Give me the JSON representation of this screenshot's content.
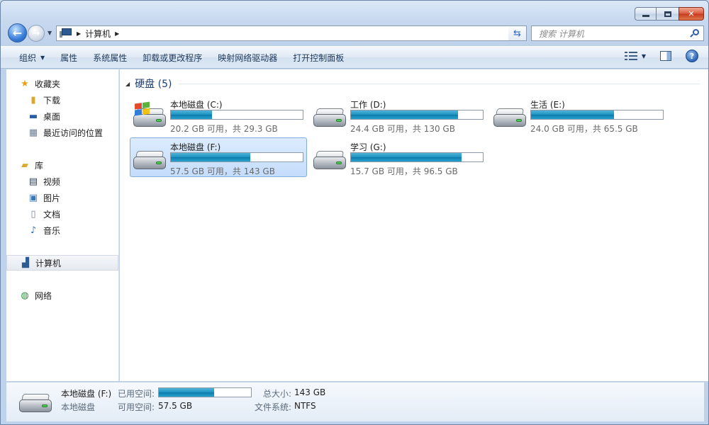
{
  "window": {
    "caption": {
      "minimize": "minimize",
      "maximize": "maximize",
      "close": "✕"
    }
  },
  "nav": {
    "back": "←",
    "forward": "→",
    "breadcrumb": [
      "计算机"
    ],
    "search_placeholder": "搜索 计算机"
  },
  "toolbar": {
    "organize": "组织",
    "items": [
      "属性",
      "系统属性",
      "卸载或更改程序",
      "映射网络驱动器",
      "打开控制面板"
    ],
    "help": "?"
  },
  "sidebar": {
    "favorites": {
      "label": "收藏夹",
      "items": [
        "下载",
        "桌面",
        "最近访问的位置"
      ]
    },
    "libraries": {
      "label": "库",
      "items": [
        "视频",
        "图片",
        "文档",
        "音乐"
      ]
    },
    "computer": "计算机",
    "network": "网络"
  },
  "content": {
    "group_title": "硬盘 (5)",
    "drives": [
      {
        "name": "本地磁盘 (C:)",
        "space": "20.2 GB 可用，共 29.3 GB",
        "used_fraction": 0.31,
        "system": true
      },
      {
        "name": "工作 (D:)",
        "space": "24.4 GB 可用，共 130 GB",
        "used_fraction": 0.81,
        "system": false
      },
      {
        "name": "生活 (E:)",
        "space": "24.0 GB 可用，共 65.5 GB",
        "used_fraction": 0.63,
        "system": false
      },
      {
        "name": "本地磁盘 (F:)",
        "space": "57.5 GB 可用，共 143 GB",
        "used_fraction": 0.6,
        "system": false,
        "selected": true
      },
      {
        "name": "学习 (G:)",
        "space": "15.7 GB 可用，共 96.5 GB",
        "used_fraction": 0.84,
        "system": false
      }
    ]
  },
  "details": {
    "name": "本地磁盘 (F:)",
    "type": "本地磁盘",
    "used_label": "已用空间:",
    "free_label": "可用空间:",
    "free_value": "57.5 GB",
    "total_label": "总大小:",
    "total_value": "143 GB",
    "fs_label": "文件系统:",
    "fs_value": "NTFS",
    "used_fraction": 0.6
  },
  "colors": {
    "bar_fill": "#1c92c1",
    "selection": "#c4ddfb"
  }
}
